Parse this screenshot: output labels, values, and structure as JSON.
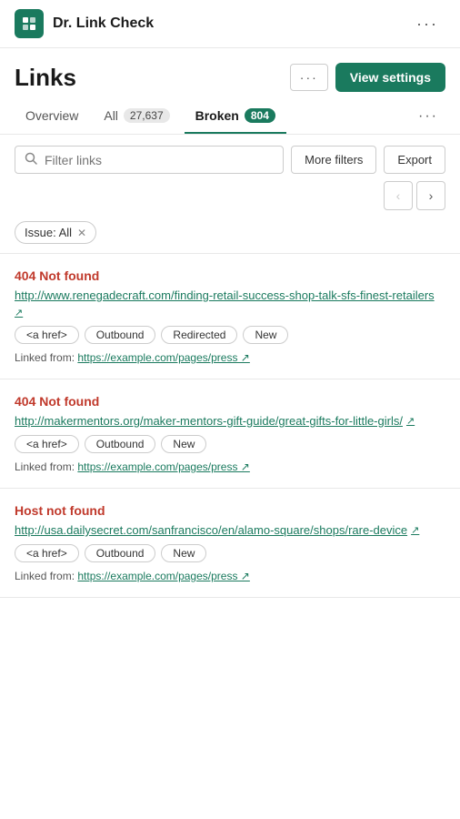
{
  "app": {
    "logo_text": "✦",
    "title": "Dr. Link Check"
  },
  "header": {
    "page_title": "Links",
    "more_btn_label": "···",
    "view_settings_label": "View settings"
  },
  "tabs": {
    "items": [
      {
        "id": "overview",
        "label": "Overview",
        "badge": null,
        "active": false
      },
      {
        "id": "all",
        "label": "All",
        "badge": "27,637",
        "active": false
      },
      {
        "id": "broken",
        "label": "Broken",
        "badge": "804",
        "active": true
      }
    ],
    "more_label": "···"
  },
  "filters": {
    "search_placeholder": "Filter links",
    "more_filters_label": "More filters",
    "export_label": "Export",
    "active_filter": "Issue: All",
    "filter_close": "✕"
  },
  "pagination": {
    "prev_label": "‹",
    "next_label": "›"
  },
  "link_cards": [
    {
      "error": "404 Not found",
      "url": "http://www.renegadecraft.com/finding-retail-success-shop-talk-sfs-finest-retailers",
      "tags": [
        "<a href>",
        "Outbound",
        "Redirected",
        "New"
      ],
      "linked_from_label": "Linked from:",
      "linked_from_url": "https://example.com/pages/press"
    },
    {
      "error": "404 Not found",
      "url": "http://makermentors.org/maker-mentors-gift-guide/great-gifts-for-little-girls/",
      "tags": [
        "<a href>",
        "Outbound",
        "New"
      ],
      "linked_from_label": "Linked from:",
      "linked_from_url": "https://example.com/pages/press"
    },
    {
      "error": "Host not found",
      "url": "http://usa.dailysecret.com/sanfrancisco/en/alamo-square/shops/rare-device",
      "tags": [
        "<a href>",
        "Outbound",
        "New"
      ],
      "linked_from_label": "Linked from:",
      "linked_from_url": "https://example.com/pages/press"
    }
  ]
}
